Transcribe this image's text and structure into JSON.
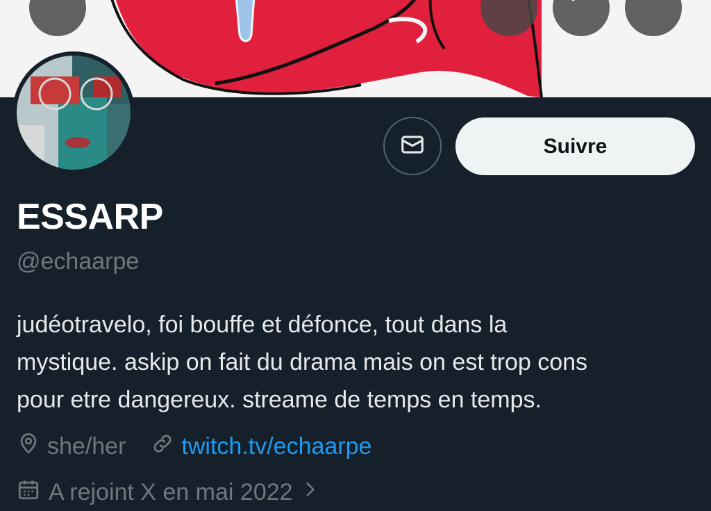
{
  "header": {
    "back_icon": "arrow-left-icon",
    "grok_icon": "grok-icon",
    "search_icon": "search-icon",
    "more_icon": "more-horizontal-icon"
  },
  "profile": {
    "name": "ESSARP",
    "handle": "@echaarpe",
    "bio_lines": [
      "judéotravelo, foi bouffe et défonce, tout dans la",
      "mystique. askip on fait du drama mais on est trop cons",
      "pour etre dangereux. streame de temps en temps."
    ],
    "pronouns": "she/her",
    "website": "twitch.tv/echaarpe",
    "joined": "A rejoint X en mai 2022"
  },
  "actions": {
    "message_icon": "mail-icon",
    "follow_label": "Suivre"
  },
  "colors": {
    "background": "#15202b",
    "link": "#1d9bf0",
    "muted": "#71767b",
    "banner_red": "#e0203c"
  }
}
